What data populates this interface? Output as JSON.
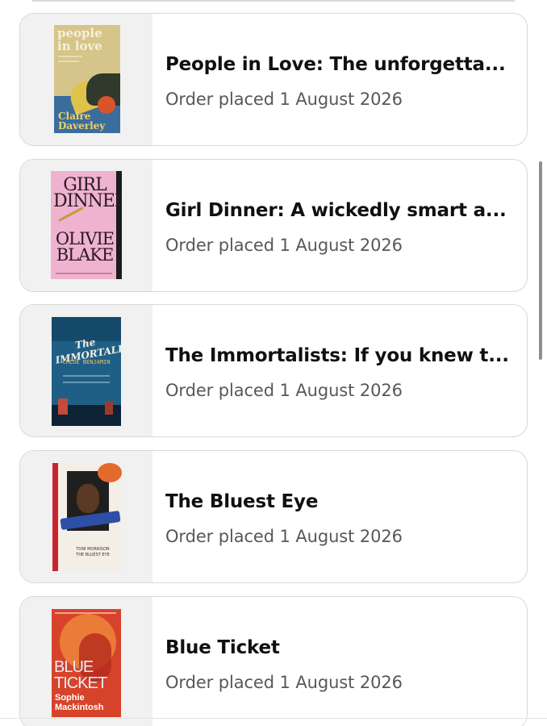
{
  "orders": [
    {
      "title": "People in Love: The unforgetta...",
      "subtitle": "Order placed 1 August 2026",
      "cover": {
        "line1": "people",
        "line2": "in love",
        "author1": "Claire",
        "author2": "Daverley"
      }
    },
    {
      "title": "Girl Dinner: A wickedly smart a...",
      "subtitle": "Order placed 1 August 2026",
      "cover": {
        "line1": "GIRL",
        "line2": "DINNER",
        "author1": "OLIVIE",
        "author2": "BLAKE"
      }
    },
    {
      "title": "The Immortalists: If you knew t...",
      "subtitle": "Order placed 1 August 2026",
      "cover": {
        "line1": "The IMMORTALISTS",
        "author1": "CHLOE BENJAMIN"
      }
    },
    {
      "title": "The Bluest Eye",
      "subtitle": "Order placed 1 August 2026",
      "cover": {
        "line1": "TONI MORRISON",
        "line2": "THE BLUEST EYE"
      }
    },
    {
      "title": "Blue Ticket",
      "subtitle": "Order placed 1 August 2026",
      "cover": {
        "line1": "BLUE TICKET",
        "author1": "Sophie Mackintosh"
      }
    }
  ],
  "colors": {
    "title": "#0f1111",
    "subtitle": "#565959",
    "card_border": "#d5d9d9",
    "thumb_bg": "#f1f1f1"
  }
}
